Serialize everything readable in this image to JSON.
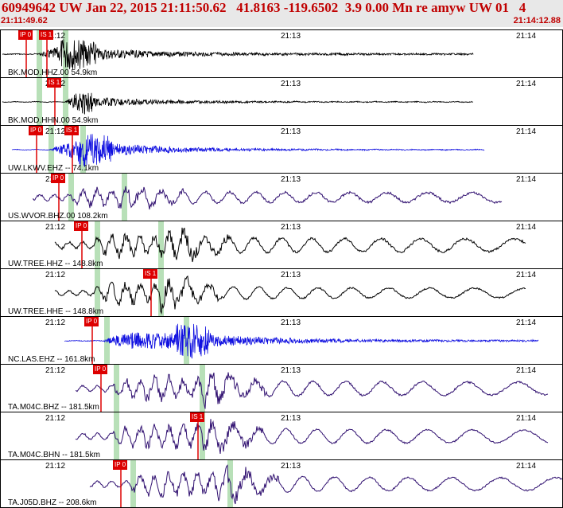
{
  "header": {
    "title": "60949642 UW Jan 22, 2015 21:11:50.62   41.8163 -119.6502  3.9 0.00 Mn re amyw UW 01   4",
    "start_time": "21:11:49.62",
    "end_time": "21:14:12.88"
  },
  "colors": {
    "header_text": "#c00000",
    "pick": "#dd0000",
    "shade": "#b8e0b8",
    "trace_black": "#000000",
    "trace_blue": "#1010e0",
    "trace_purple": "#301070"
  },
  "panels": [
    {
      "label": "BK.MOD.HHZ.00 54.9km",
      "ticks": [
        "21:12",
        "21:13",
        "21:14"
      ],
      "picks": [
        "IP 0",
        "IS 1"
      ],
      "color": "trace_black"
    },
    {
      "label": "BK.MOD.HHN.00 54.9km",
      "ticks": [
        "21:12",
        "21:13",
        "21:14"
      ],
      "picks": [
        "IS 1"
      ],
      "color": "trace_black"
    },
    {
      "label": "UW.LKWV.EHZ -- 74.1km",
      "ticks": [
        "21:12",
        "21:13",
        "21:14"
      ],
      "picks": [
        "IP 0",
        "IS 1"
      ],
      "color": "trace_blue"
    },
    {
      "label": "US.WVOR.BHZ.00 108.2km",
      "ticks": [
        "21:12",
        "21:13",
        "21:14"
      ],
      "picks": [
        "IP 0"
      ],
      "color": "trace_purple"
    },
    {
      "label": "UW.TREE.HHZ -- 148.8km",
      "ticks": [
        "21:12",
        "21:13",
        "21:14"
      ],
      "picks": [
        "IP 0"
      ],
      "color": "trace_black"
    },
    {
      "label": "UW.TREE.HHE -- 148.8km",
      "ticks": [
        "21:12",
        "21:13",
        "21:14"
      ],
      "picks": [
        "IS 1"
      ],
      "color": "trace_black"
    },
    {
      "label": "NC.LAS.EHZ -- 161.8km",
      "ticks": [
        "21:12",
        "21:13",
        "21:14"
      ],
      "picks": [
        "IP 0"
      ],
      "color": "trace_blue"
    },
    {
      "label": "TA.M04C.BHZ -- 181.5km",
      "ticks": [
        "21:12",
        "21:13",
        "21:14"
      ],
      "picks": [
        "IP 0"
      ],
      "color": "trace_purple"
    },
    {
      "label": "TA.M04C.BHN -- 181.5km",
      "ticks": [
        "21:12",
        "21:13",
        "21:14"
      ],
      "picks": [
        "IS 1"
      ],
      "color": "trace_purple"
    },
    {
      "label": "TA.J05D.BHZ -- 208.6km",
      "ticks": [
        "21:12",
        "21:13",
        "21:14"
      ],
      "picks": [
        "IP 0"
      ],
      "color": "trace_purple"
    }
  ]
}
